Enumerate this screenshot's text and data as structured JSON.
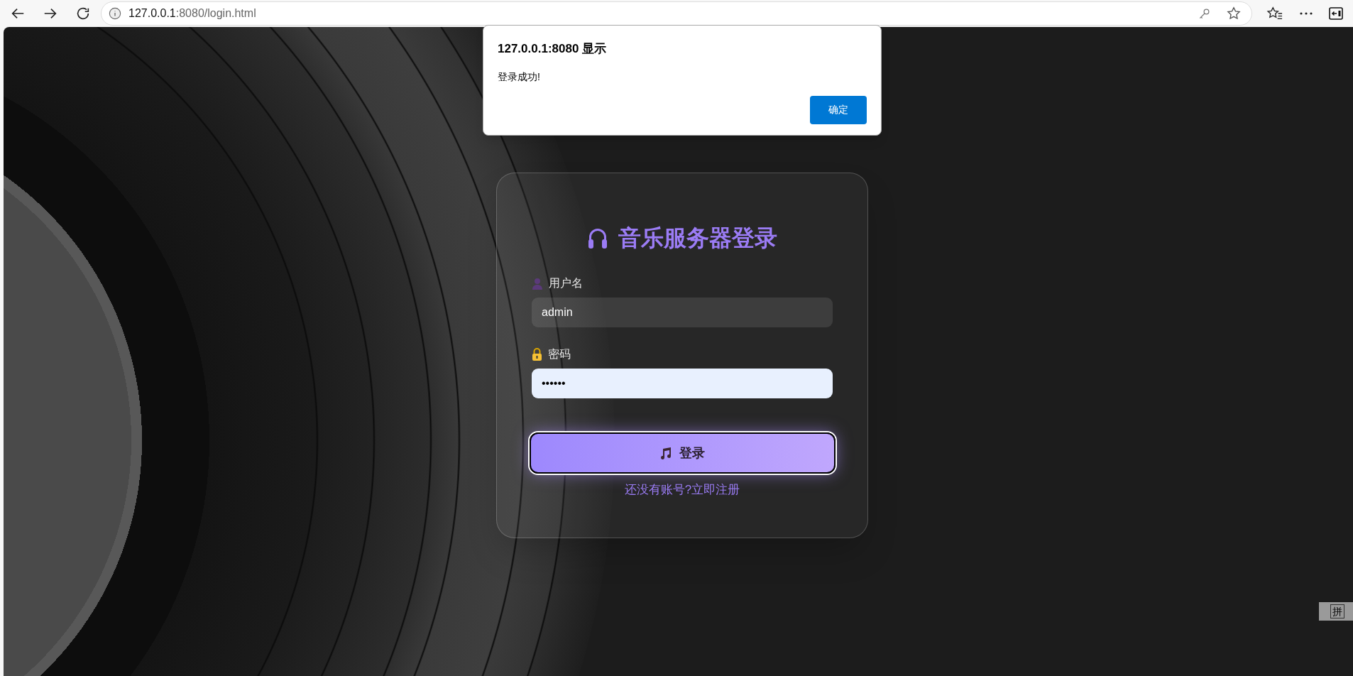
{
  "browser": {
    "address": {
      "host": "127.0.0.1",
      "rest": ":8080/login.html"
    }
  },
  "dialog": {
    "title": "127.0.0.1:8080 显示",
    "message": "登录成功!",
    "button": "确定"
  },
  "login": {
    "title": "音乐服务器登录",
    "fields": [
      {
        "kind": "user",
        "label": "用户名",
        "value": "admin",
        "autofilled": false
      },
      {
        "kind": "lock",
        "label": "密码",
        "value": "••••••",
        "autofilled": true
      }
    ],
    "button": "登录",
    "register_link": "还没有账号?立即注册"
  },
  "ime_indicator": {
    "label": "拼"
  }
}
